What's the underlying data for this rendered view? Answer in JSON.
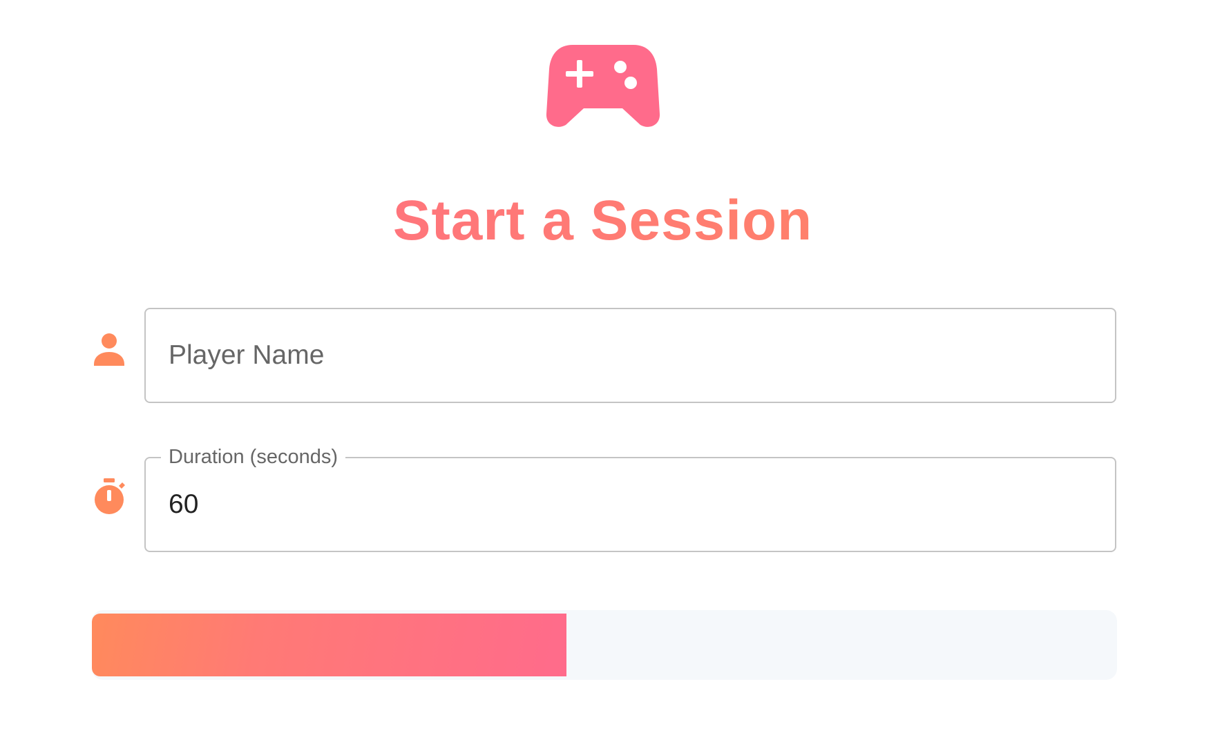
{
  "app": {
    "logo_icon": "gamepad-icon",
    "title": "Start a Session"
  },
  "form": {
    "player_name": {
      "icon": "person-icon",
      "placeholder": "Player Name",
      "value": ""
    },
    "duration": {
      "icon": "stopwatch-icon",
      "label": "Duration (seconds)",
      "value": "60"
    }
  },
  "progress": {
    "fraction": 0.463
  },
  "colors": {
    "accent_pink": "#ff6b8b",
    "accent_orange": "#ff8a5c",
    "track": "#f5f8fb"
  }
}
